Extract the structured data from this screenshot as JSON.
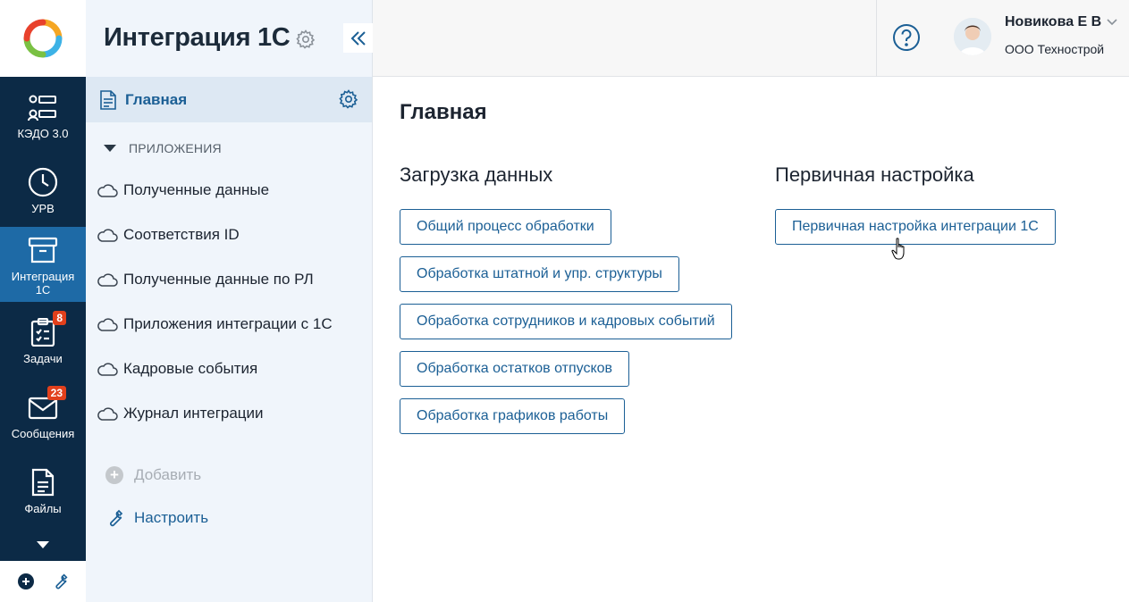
{
  "rail": {
    "items": [
      {
        "label": "КЭДО 3.0",
        "icon": "kedo-icon"
      },
      {
        "label": "УРВ",
        "icon": "clock-icon"
      },
      {
        "label": "Интеграция 1С",
        "icon": "archive-box-icon"
      },
      {
        "label": "Задачи",
        "icon": "clipboard-checklist-icon",
        "badge": "8"
      },
      {
        "label": "Сообщения",
        "icon": "envelope-icon",
        "badge": "23"
      },
      {
        "label": "Файлы",
        "icon": "file-icon"
      }
    ]
  },
  "sidebar": {
    "title": "Интеграция 1С",
    "main_item": "Главная",
    "section_header": "ПРИЛОЖЕНИЯ",
    "apps": [
      "Полученные данные",
      "Соответствия ID",
      "Полученные данные по РЛ",
      "Приложения интеграции с 1С",
      "Кадровые события",
      "Журнал интеграции"
    ],
    "add_label": "Добавить",
    "configure_label": "Настроить"
  },
  "header": {
    "user_name": "Новикова Е В",
    "user_org": "ООО Технострой"
  },
  "main": {
    "page_title": "Главная",
    "column_left": {
      "title": "Загрузка данных",
      "buttons": [
        "Общий процесс обработки",
        "Обработка штатной и упр. структуры",
        "Обработка сотрудников и кадровых событий",
        "Обработка остатков отпусков",
        "Обработка графиков работы"
      ]
    },
    "column_right": {
      "title": "Первичная настройка",
      "buttons": [
        "Первичная настройка интеграции 1С"
      ]
    }
  },
  "colors": {
    "rail_bg": "#0c2a46",
    "rail_active": "#1e6aa6",
    "accent": "#1b5f95",
    "badge": "#e2401c",
    "sidebar_bg": "#f0f5fb"
  }
}
